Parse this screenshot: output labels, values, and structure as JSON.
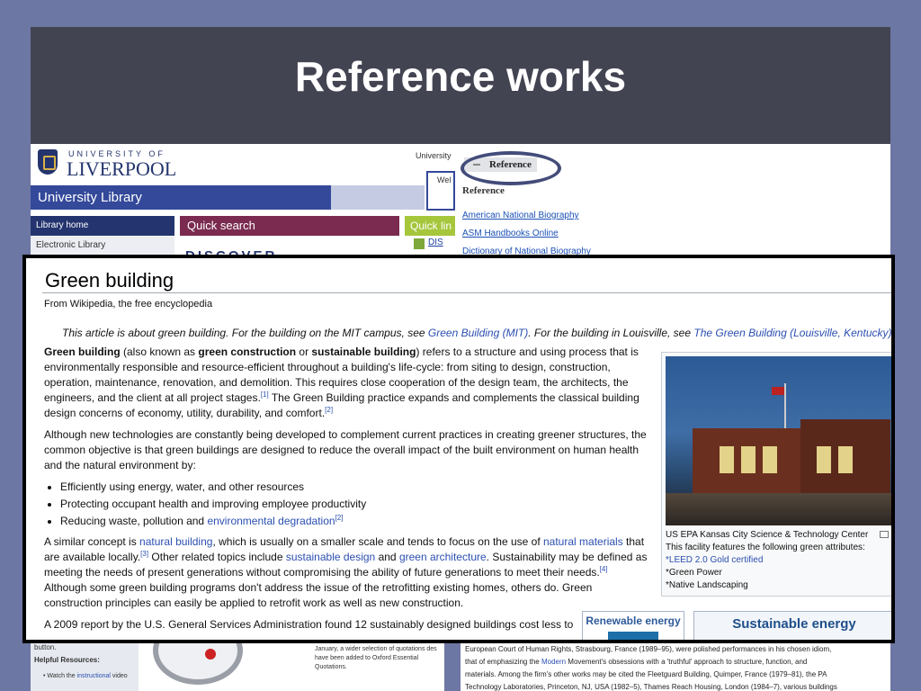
{
  "slide": {
    "title": "Reference works"
  },
  "liverpool": {
    "top_label": "UNIVERSITY OF",
    "name": "LIVERPOOL",
    "corner_text": "University",
    "welcome_text": "Wel",
    "library_bar": "University Library",
    "menu_home": "Library home",
    "menu_electronic": "Electronic Library",
    "quick_search": "Quick search",
    "quick_links": "Quick lin",
    "dis_link": "DIS",
    "discover": "DISCOVER"
  },
  "reference": {
    "tab_label": "Reference",
    "heading": "Reference",
    "links": [
      "American National Biography",
      "ASM Handbooks Online",
      "Dictionary of National Biography"
    ]
  },
  "wiki": {
    "title": "Green building",
    "subtitle": "From Wikipedia, the free encyclopedia",
    "hatnote": {
      "t1": "This article is about green building. For the building on the MIT campus, see ",
      "l1": "Green Building (MIT)",
      "t2": ". For the building in Louisville, see ",
      "l2": "The Green Building (Louisville, Kentucky)",
      "t3": "."
    },
    "p1": {
      "b1": "Green building",
      "t1": " (also known as ",
      "b2": "green construction",
      "t2": " or ",
      "b3": "sustainable building",
      "t3": ") refers to a structure and using process that is environmentally responsible and resource-efficient throughout a building's life-cycle: from siting to design, construction, operation, maintenance, renovation, and demolition. This requires close cooperation of the design team, the architects, the engineers, and the client at all project stages.",
      "r1": "[1]",
      "t4": " The Green Building practice expands and complements the classical building design concerns of economy, utility, durability, and comfort.",
      "r2": "[2]"
    },
    "p2": "Although new technologies are constantly being developed to complement current practices in creating greener structures, the common objective is that green buildings are designed to reduce the overall impact of the built environment on human health and the natural environment by:",
    "bullets": {
      "b1": "Efficiently using energy, water, and other resources",
      "b2": "Protecting occupant health and improving employee productivity",
      "b3_text": "Reducing waste, pollution and ",
      "b3_link": "environmental degradation",
      "b3_ref": "[2]"
    },
    "p3": {
      "t1": "A similar concept is ",
      "l1": "natural building",
      "t2": ", which is usually on a smaller scale and tends to focus on the use of ",
      "l2": "natural materials",
      "t3": " that are available locally.",
      "r1": "[3]",
      "t4": " Other related topics include ",
      "l3": "sustainable design",
      "t5": " and ",
      "l4": "green architecture",
      "t6": ". Sustainability may be defined as meeting the needs of present generations without compromising the ability of future generations to meet their needs.",
      "r2": "[4]",
      "t7": " Although some green building programs don't address the issue of the retrofitting existing homes, others do. Green construction principles can easily be applied to retrofit work as well as new construction."
    },
    "p4": "A 2009 report by the U.S. General Services Administration found 12 sustainably designed buildings cost less to",
    "infobox": {
      "line1": "US EPA Kansas City Science & Technology Center",
      "line2": "This facility features the following green attributes:",
      "line3": "*LEED 2.0 Gold certified",
      "line4": "*Green Power",
      "line5": "*Native Landscaping"
    },
    "nav_renewable": "Renewable energy",
    "nav_sustainable": "Sustainable energy"
  },
  "bottom": {
    "button_text": "button.",
    "helpful": "Helpful Resources:",
    "watch_prefix": "Watch the ",
    "watch_link": "instructional",
    "watch_suffix": " video",
    "quote_text": "January, a wider selection of quotations des have been added to Oxford Essential Quotations.",
    "right_line1": "European Court of Human Rights, Strasbourg, France (1989–95), were polished performances in his chosen idiom,",
    "right_line2_a": "that of emphasizing the ",
    "right_line2_link": "Modern",
    "right_line2_b": " Movement's obsessions with a 'truthful' approach to structure, function, and",
    "right_line3": "materials. Among the firm's other works may be cited the Fleetguard Building, Quimper, France (1979–81), the PA",
    "right_line4": "Technology Laboratories, Princeton, NJ, USA (1982–5), Thames Reach Housing, London (1984–7), various buildings"
  },
  "colors": {
    "slide_bg": "#6d77a4",
    "title_bar": "#434452",
    "wiki_link": "#2b4fb0"
  }
}
